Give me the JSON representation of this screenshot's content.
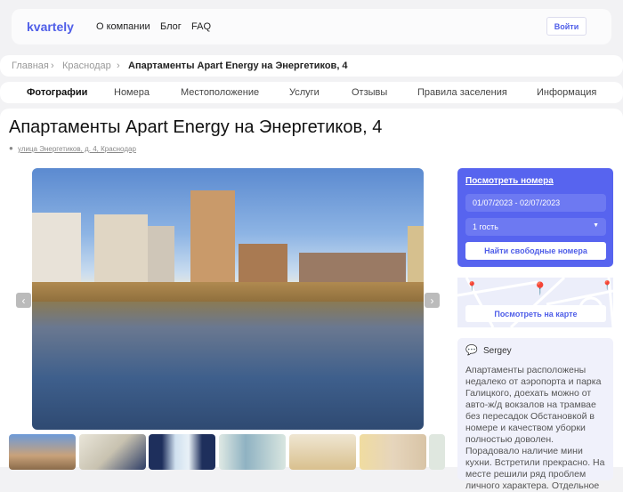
{
  "header": {
    "logo": "kvartely",
    "nav": [
      "О компании",
      "Блог",
      "FAQ"
    ],
    "login": "Войти"
  },
  "breadcrumb": [
    "Главная",
    "Краснодар",
    "Апартаменты Apart Energy на Энергетиков, 4"
  ],
  "tabs": [
    "Фотографии",
    "Номера",
    "Местоположение",
    "Услуги",
    "Отзывы",
    "Правила заселения",
    "Информация"
  ],
  "title": "Апартаменты Apart Energy на Энергетиков, 4",
  "address": "улица Энергетиков, д. 4, Краснодар",
  "booking": {
    "title": "Посмотреть номера",
    "dates": "01/07/2023 - 02/07/2023",
    "guests": "1 гость",
    "find": "Найти свободные номера"
  },
  "map": {
    "button": "Посмотреть на карте"
  },
  "review": {
    "author": "Sergey",
    "text": "Апартаменты расположены недалеко от аэропорта и парка Галицкого, доехать можно от авто-ж/д вокзалов на трамвае без пересадок Обстановкой в номере и качеством уборки полностью доволен. Порадовало наличие мини кухни. Встретили прекрасно. На месте решили ряд проблем личного характера. Отдельное"
  },
  "colors": {
    "accent": "#5764ef",
    "pin": "#ef4444"
  }
}
